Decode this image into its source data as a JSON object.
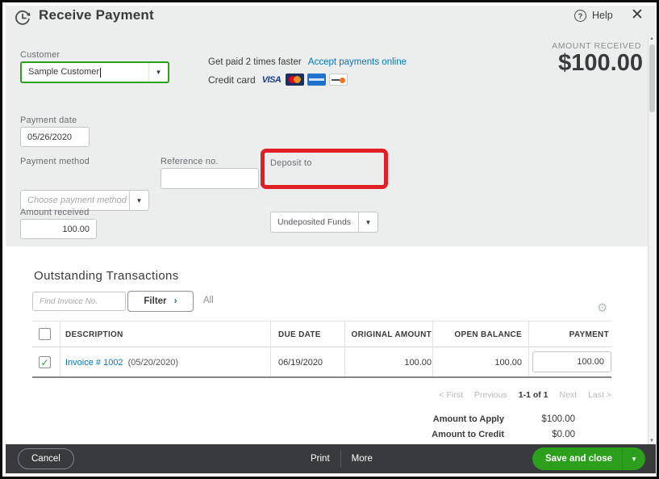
{
  "colors": {
    "accent_green": "#2ca01c",
    "link_blue": "#0077c5",
    "highlight_red": "#e01e25",
    "footer_bg": "#393a3d",
    "panel_gray": "#eceeee"
  },
  "header": {
    "title": "Receive Payment",
    "help_label": "Help"
  },
  "amount_panel": {
    "label": "AMOUNT RECEIVED",
    "value": "$100.00"
  },
  "customer": {
    "label": "Customer",
    "value": "Sample Customer"
  },
  "promo": {
    "text": "Get paid 2 times faster",
    "link_label": "Accept payments online",
    "credit_card_label": "Credit card",
    "cards": [
      "Visa",
      "Mastercard",
      "American Express",
      "Discover"
    ]
  },
  "fields": {
    "payment_date": {
      "label": "Payment date",
      "value": "05/26/2020"
    },
    "payment_method": {
      "label": "Payment method",
      "placeholder": "Choose payment method"
    },
    "reference_no": {
      "label": "Reference no.",
      "value": ""
    },
    "deposit_to": {
      "label": "Deposit to",
      "value": "Undeposited Funds"
    },
    "amount_received": {
      "label": "Amount received",
      "value": "100.00"
    }
  },
  "outstanding": {
    "title": "Outstanding Transactions",
    "find_placeholder": "Find Invoice No.",
    "filter_label": "Filter",
    "all_label": "All",
    "table": {
      "columns": [
        "DESCRIPTION",
        "DUE DATE",
        "ORIGINAL AMOUNT",
        "OPEN BALANCE",
        "PAYMENT"
      ],
      "rows": [
        {
          "checked": true,
          "invoice_link": "Invoice # 1002",
          "invoice_date": "(05/20/2020)",
          "due_date": "06/19/2020",
          "original_amount": "100.00",
          "open_balance": "100.00",
          "payment": "100.00"
        }
      ]
    },
    "pagination": {
      "first": "< First",
      "previous": "Previous",
      "range": "1-1 of 1",
      "next": "Next",
      "last": "Last >"
    }
  },
  "summary": {
    "amount_to_apply_label": "Amount to Apply",
    "amount_to_apply_value": "$100.00",
    "amount_to_credit_label": "Amount to Credit",
    "amount_to_credit_value": "$0.00"
  },
  "footer": {
    "cancel_label": "Cancel",
    "print_label": "Print",
    "more_label": "More",
    "save_label": "Save and close"
  }
}
